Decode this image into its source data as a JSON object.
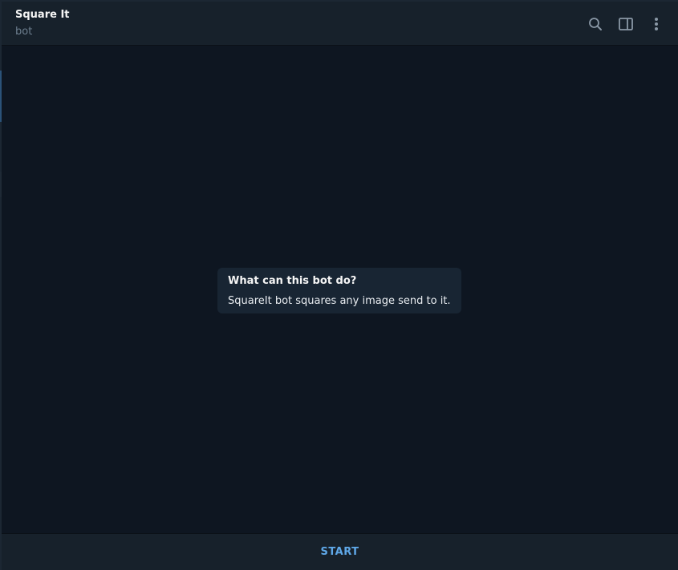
{
  "header": {
    "title": "Square It",
    "subtitle": "bot",
    "icons": [
      "search-icon",
      "sidebar-toggle-icon",
      "more-vertical-icon"
    ]
  },
  "info_card": {
    "title": "What can this bot do?",
    "description": "SquareIt bot squares any image send to it."
  },
  "bottom_bar": {
    "start_label": "START"
  },
  "colors": {
    "background": "#0e1621",
    "panel": "#17212b",
    "card": "#182533",
    "accent": "#5fa8e8",
    "muted_text": "#6d7f8f"
  }
}
